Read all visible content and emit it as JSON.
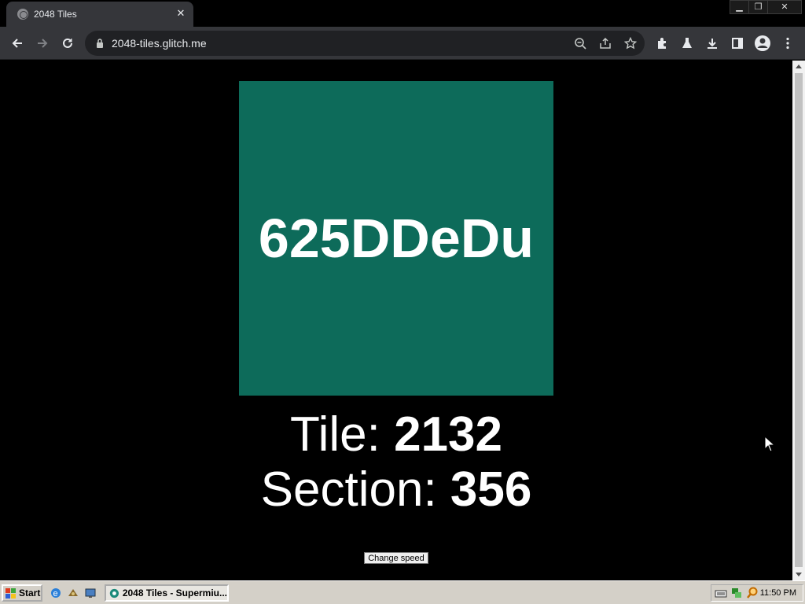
{
  "browser": {
    "tab_title": "2048 Tiles",
    "tab_close": "✕",
    "url": "2048-tiles.glitch.me",
    "window_controls": {
      "minimize": "▁",
      "maximize": "❐",
      "close": "✕"
    }
  },
  "page": {
    "tile_label": "625DDeDu",
    "tile_color": "#0d6b5a",
    "tile_prefix": "Tile: ",
    "tile_number": "2132",
    "section_prefix": "Section: ",
    "section_number": "356",
    "change_speed_label": "Change speed"
  },
  "taskbar": {
    "start_label": "Start",
    "task_label": "2048 Tiles - Supermiu...",
    "clock": "11:50 PM"
  }
}
